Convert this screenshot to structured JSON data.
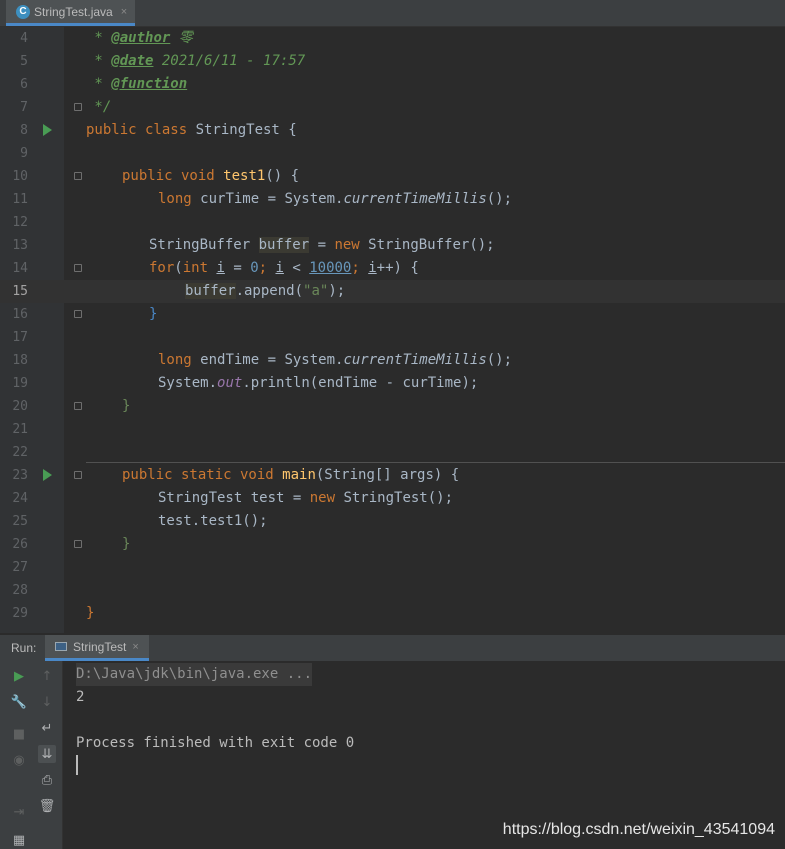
{
  "tab": {
    "icon": "C",
    "filename": "StringTest.java",
    "close": "×"
  },
  "editor": {
    "lines": [
      {
        "n": "4"
      },
      {
        "n": "5"
      },
      {
        "n": "6"
      },
      {
        "n": "7"
      },
      {
        "n": "8"
      },
      {
        "n": "9"
      },
      {
        "n": "10"
      },
      {
        "n": "11"
      },
      {
        "n": "12"
      },
      {
        "n": "13"
      },
      {
        "n": "14"
      },
      {
        "n": "15"
      },
      {
        "n": "16"
      },
      {
        "n": "17"
      },
      {
        "n": "18"
      },
      {
        "n": "19"
      },
      {
        "n": "20"
      },
      {
        "n": "21"
      },
      {
        "n": "22"
      },
      {
        "n": "23"
      },
      {
        "n": "24"
      },
      {
        "n": "25"
      },
      {
        "n": "26"
      },
      {
        "n": "27"
      },
      {
        "n": "28"
      },
      {
        "n": "29"
      }
    ],
    "code": {
      "l4": {
        "star": " * ",
        "tag": "@author",
        "val": " 零"
      },
      "l5": {
        "star": " * ",
        "tag": "@date",
        "val": " 2021/6/11 - 17:57"
      },
      "l6": {
        "star": " * ",
        "tag": "@function"
      },
      "l7": {
        "text": " */"
      },
      "l8": {
        "kw": "public class ",
        "name": "StringTest",
        "brace": " {"
      },
      "l10": {
        "kw": "public void ",
        "fn": "test1",
        "rest": "() {"
      },
      "l11": {
        "kw": "long ",
        "a": "curTime = System.",
        "m": "currentTimeMillis",
        "b": "();"
      },
      "l13": {
        "a": "StringBuffer ",
        "v": "buffer",
        "eq": " = ",
        "kw": "new ",
        "b": "StringBuffer();"
      },
      "l14": {
        "kw": "for",
        "a": "(",
        "kw2": "int ",
        "i1": "i",
        "b": " = ",
        "n0": "0",
        "c": "; ",
        "i2": "i",
        "d": " < ",
        "n1": "10000",
        "e": "; ",
        "i3": "i",
        "f": "++) {"
      },
      "l15": {
        "v": "buffer",
        "a": ".append(",
        "s": "\"a\"",
        "b": ");"
      },
      "l16": {
        "text": "}"
      },
      "l18": {
        "kw": "long ",
        "a": "endTime = System.",
        "m": "currentTimeMillis",
        "b": "();"
      },
      "l19": {
        "a": "System.",
        "out": "out",
        "b": ".println(endTime - curTime);"
      },
      "l20": {
        "text": "}"
      },
      "l23": {
        "kw": "public static void ",
        "fn": "main",
        "rest": "(String[] args) {"
      },
      "l24": {
        "a": "StringTest test = ",
        "kw": "new ",
        "b": "StringTest();"
      },
      "l25": {
        "text": "test.test1();"
      },
      "l26": {
        "text": "}"
      },
      "l29": {
        "text": "}"
      }
    }
  },
  "run": {
    "label": "Run:",
    "tab_name": "StringTest",
    "tab_close": "×",
    "console": {
      "cmd": "D:\\Java\\jdk\\bin\\java.exe ...",
      "out1": "2",
      "out2": "Process finished with exit code 0"
    },
    "tools": {
      "run": "▶",
      "up": "↑",
      "down": "↓",
      "wrap": "↵",
      "scroll": "⇊",
      "wrench": "🔧",
      "stop": "■",
      "camera": "◉",
      "print": "⎙",
      "trash": "🗑",
      "login": "⇥",
      "layout": "▦"
    }
  },
  "watermark": "https://blog.csdn.net/weixin_43541094"
}
